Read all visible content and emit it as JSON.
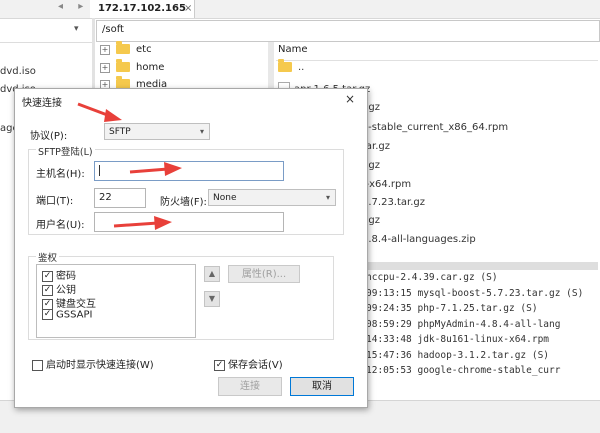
{
  "top_bar": {
    "nav_arrows": "◂ ▸",
    "host_tab": "172.17.102.165",
    "tab_close": "×"
  },
  "left_pane": {
    "items": [
      "dvd.iso",
      "dvd.iso",
      "ages.t"
    ]
  },
  "path": "/soft",
  "tree": [
    {
      "expander": "+",
      "name": "etc"
    },
    {
      "expander": "+",
      "name": "home"
    },
    {
      "expander": "+",
      "name": "media"
    }
  ],
  "files": {
    "header_name": "Name",
    "rows": [
      "..",
      "apr-1.6.5.tar.gz",
      "r.gz",
      "e-stable_current_x86_64.rpm",
      "tar.gz",
      "r.gz",
      "r-x64.rpm",
      "5.7.23.tar.gz",
      "r.gz",
      "4.8.4-all-languages.zip"
    ]
  },
  "log": [
    "nccpu-2.4.39.car.gz (S)",
    "09:13:15 mysql-boost-5.7.23.tar.gz (S)",
    "09:24:35 php-7.1.25.tar.gz (S)",
    "08:59:29 phpMyAdmin-4.8.4-all-lang",
    "14:33:48 jdk-8u161-linux-x64.rpm",
    "15:47:36 hadoop-3.1.2.tar.gz (S)",
    "12:05:53 google-chrome-stable_curr"
  ],
  "dialog": {
    "title": "快速连接",
    "close": "×",
    "protocol_label": "协议(P):",
    "protocol_value": "SFTP",
    "login_group": "SFTP登陆(L)",
    "host_label": "主机名(H):",
    "host_value": "",
    "port_label": "端口(T):",
    "port_value": "22",
    "firewall_label": "防火墙(F):",
    "firewall_value": "None",
    "username_label": "用户名(U):",
    "username_value": "",
    "auth_group": "鉴权",
    "auth_methods": [
      {
        "label": "密码",
        "checked": true
      },
      {
        "label": "公钥",
        "checked": true
      },
      {
        "label": "键盘交互",
        "checked": true
      },
      {
        "label": "GSSAPI",
        "checked": true
      }
    ],
    "properties_button": "属性(R)...",
    "startup_checkbox_label": "启动时显示快速连接(W)",
    "startup_checked": false,
    "save_session_label": "保存会话(V)",
    "save_session_checked": true,
    "connect_button": "连接",
    "cancel_button": "取消"
  },
  "colors": {
    "annotation_arrow": "#e8403a",
    "focus_border": "#7a9cc6",
    "folder": "#f5c94d"
  }
}
